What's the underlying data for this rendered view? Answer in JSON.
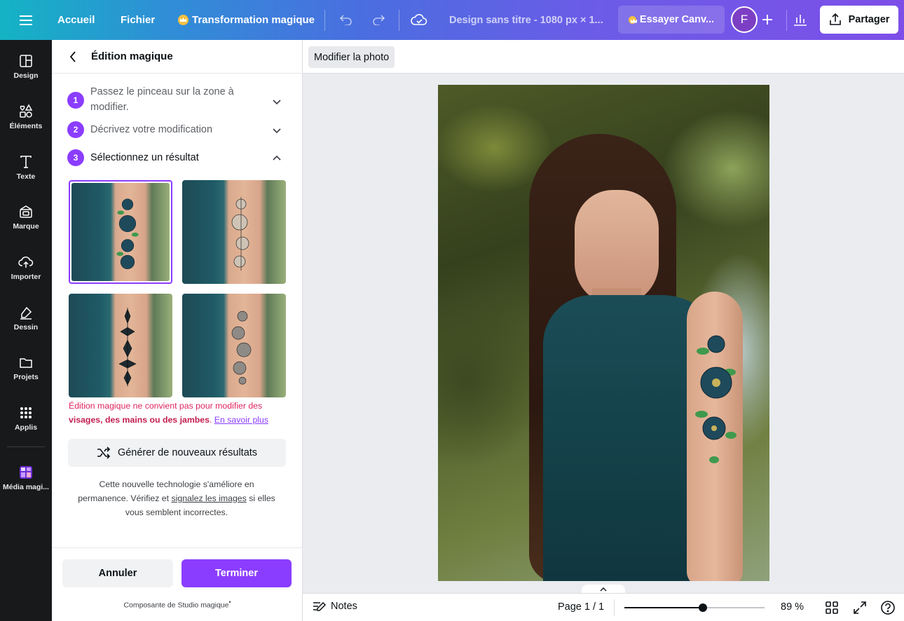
{
  "topbar": {
    "home": "Accueil",
    "file": "Fichier",
    "magic_switch": "Transformation magique",
    "doc_title": "Design sans titre - 1080 px × 1...",
    "try_pro": "Essayer Canv...",
    "avatar_initial": "F",
    "share": "Partager"
  },
  "rail": {
    "items": [
      {
        "label": "Design",
        "icon": "layout-icon"
      },
      {
        "label": "Éléments",
        "icon": "shapes-icon"
      },
      {
        "label": "Texte",
        "icon": "text-icon"
      },
      {
        "label": "Marque",
        "icon": "brand-icon"
      },
      {
        "label": "Importer",
        "icon": "cloud-upload-icon"
      },
      {
        "label": "Dessin",
        "icon": "draw-icon"
      },
      {
        "label": "Projets",
        "icon": "folder-icon"
      },
      {
        "label": "Applis",
        "icon": "apps-grid-icon"
      },
      {
        "label": "Média magi...",
        "icon": "magic-media-icon"
      }
    ]
  },
  "panel": {
    "title": "Édition magique",
    "steps": [
      {
        "num": "1",
        "text": "Passez le pinceau sur la zone à modifier."
      },
      {
        "num": "2",
        "text": "Décrivez votre modification"
      },
      {
        "num": "3",
        "text": "Sélectionnez un résultat"
      }
    ],
    "warning_part1": "Édition magique ne convient pas pour modifier des ",
    "warning_bold": "visages, des mains ou des jambes",
    "warning_part2": ". ",
    "warning_link": "En savoir plus",
    "generate": "Générer de nouveaux résultats",
    "note_part1": "Cette nouvelle technologie s'améliore en permanence. Vérifiez et ",
    "note_link": "signalez les images",
    "note_part2": " si elles vous semblent incorrectes.",
    "cancel": "Annuler",
    "done": "Terminer",
    "studio": "Composante de Studio magique",
    "studio_mark": "•"
  },
  "context": {
    "edit_photo": "Modifier la photo"
  },
  "bottombar": {
    "notes": "Notes",
    "page": "Page 1 / 1",
    "zoom": "89 %",
    "zoom_fraction": 0.56
  },
  "colors": {
    "accent": "#8b3dff",
    "warning": "#e0245e"
  }
}
